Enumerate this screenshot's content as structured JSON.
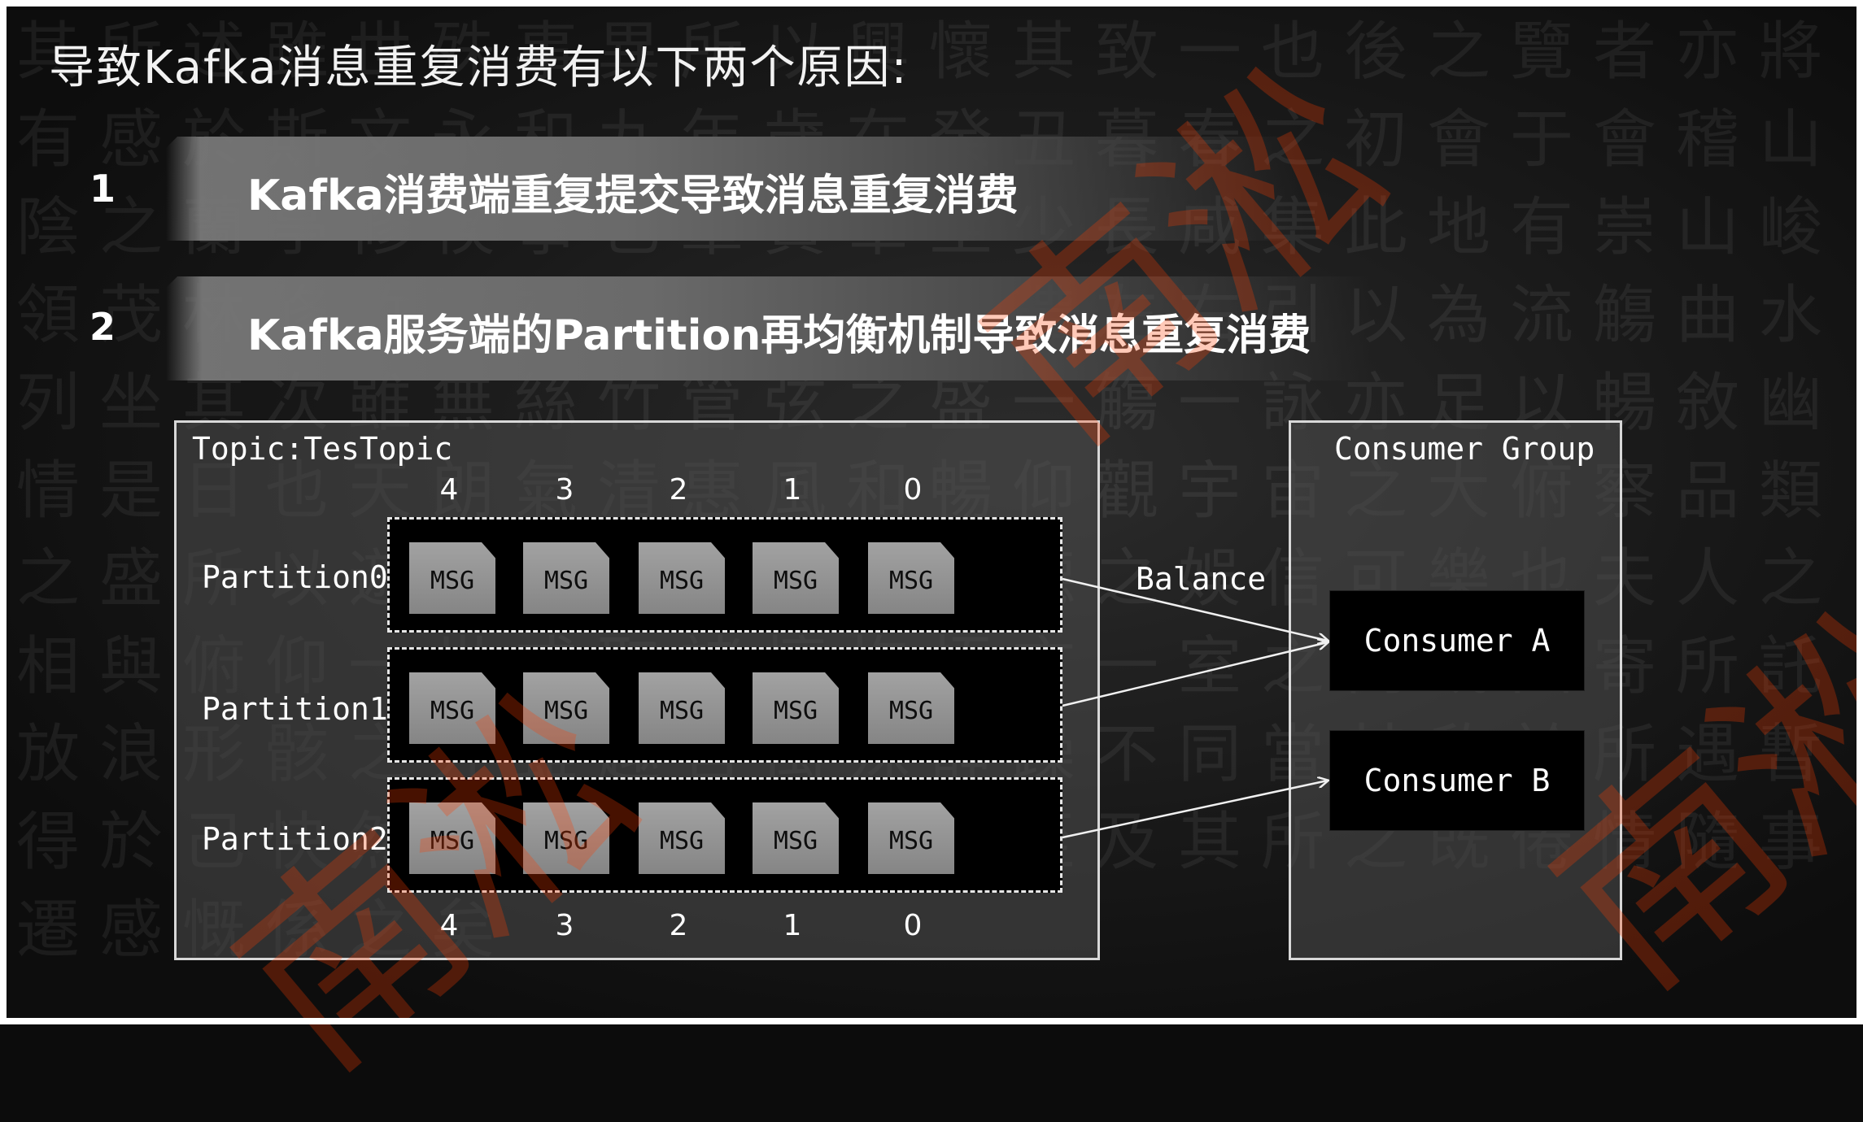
{
  "title": "导致Kafka消息重复消费有以下两个原因:",
  "reasons": [
    {
      "number": "1",
      "text": "Kafka消费端重复提交导致消息重复消费"
    },
    {
      "number": "2",
      "text": "Kafka服务端的Partition再均衡机制导致消息重复消费"
    }
  ],
  "diagram": {
    "topic_label": "Topic:TesTopic",
    "offsets_top": [
      "4",
      "3",
      "2",
      "1",
      "0"
    ],
    "offsets_bottom": [
      "4",
      "3",
      "2",
      "1",
      "0"
    ],
    "partitions": [
      {
        "label": "Partition0",
        "messages": [
          "MSG",
          "MSG",
          "MSG",
          "MSG",
          "MSG"
        ]
      },
      {
        "label": "Partition1",
        "messages": [
          "MSG",
          "MSG",
          "MSG",
          "MSG",
          "MSG"
        ]
      },
      {
        "label": "Partition2",
        "messages": [
          "MSG",
          "MSG",
          "MSG",
          "MSG",
          "MSG"
        ]
      }
    ],
    "balance_label": "Balance",
    "group_label": "Consumer Group",
    "consumers": [
      "Consumer A",
      "Consumer B"
    ]
  },
  "watermark_glyph": "南淞"
}
